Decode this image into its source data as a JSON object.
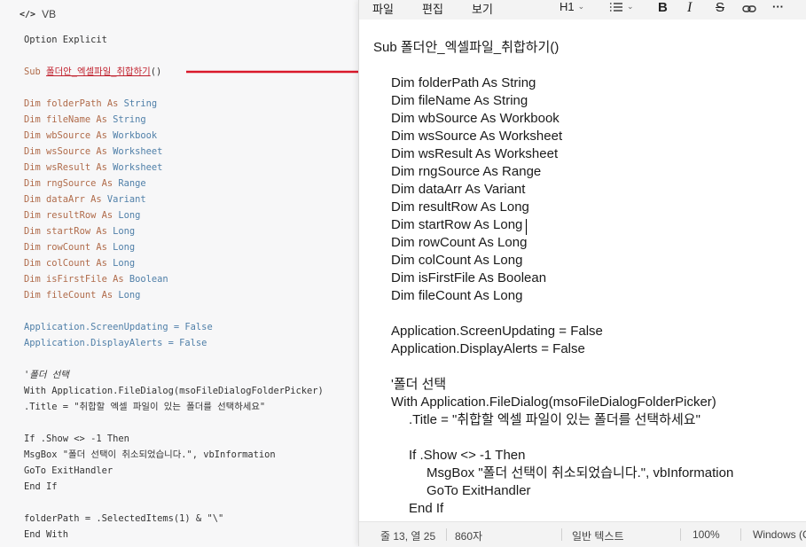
{
  "left_panel": {
    "lang_icon": "code-icon",
    "lang_label": "VB",
    "lines": {
      "option": "Option Explicit",
      "sub_kw": "Sub ",
      "sub_name": "폴더안_엑셀파일_취합하기",
      "sub_paren": "()",
      "dims": [
        {
          "name": "folderPath",
          "type": "String"
        },
        {
          "name": "fileName",
          "type": "String"
        },
        {
          "name": "wbSource",
          "type": "Workbook"
        },
        {
          "name": "wsSource",
          "type": "Worksheet"
        },
        {
          "name": "wsResult",
          "type": "Worksheet"
        },
        {
          "name": "rngSource",
          "type": "Range"
        },
        {
          "name": "dataArr",
          "type": "Variant"
        },
        {
          "name": "resultRow",
          "type": "Long"
        },
        {
          "name": "startRow",
          "type": "Long"
        },
        {
          "name": "rowCount",
          "type": "Long"
        },
        {
          "name": "colCount",
          "type": "Long"
        },
        {
          "name": "isFirstFile",
          "type": "Boolean"
        },
        {
          "name": "fileCount",
          "type": "Long"
        }
      ],
      "dim_kw": "Dim ",
      "as_kw": " As ",
      "screen_updating": "Application.ScreenUpdating = False",
      "display_alerts": "Application.DisplayAlerts = False",
      "comment": "'폴더 선택",
      "with_line": "With Application.FileDialog(msoFileDialogFolderPicker)",
      "title_line": ".Title = \"취합할 엑셀 파일이 있는 폴더를 선택하세요\"",
      "if_line": "If .Show <> -1 Then",
      "msgbox_line": "MsgBox \"폴더 선택이 취소되었습니다.\", vbInformation",
      "goto_line": "GoTo ExitHandler",
      "endif_line": "End If",
      "folderpath_line": "folderPath = .SelectedItems(1) & \"\\\"",
      "endwith_line": "End With"
    }
  },
  "notepad": {
    "menu": {
      "file": "파일",
      "edit": "편집",
      "view": "보기"
    },
    "toolbar": {
      "heading": "H1",
      "list_icon": "list-icon",
      "bold": "B",
      "italic": "I",
      "strike": "S",
      "link_icon": "link-icon",
      "more": "···"
    },
    "editor_lines": {
      "sub": "Sub 폴더안_엑셀파일_취합하기()",
      "dims": [
        "Dim folderPath As String",
        "Dim fileName As String",
        "Dim wbSource As Workbook",
        "Dim wsSource As Worksheet",
        "Dim wsResult As Worksheet",
        "Dim rngSource As Range",
        "Dim dataArr As Variant",
        "Dim resultRow As Long",
        "Dim startRow As Long",
        "Dim rowCount As Long",
        "Dim colCount As Long",
        "Dim isFirstFile As Boolean",
        "Dim fileCount As Long"
      ],
      "screen_updating": "Application.ScreenUpdating = False",
      "display_alerts": "Application.DisplayAlerts = False",
      "comment": "'폴더 선택",
      "with_line": "With Application.FileDialog(msoFileDialogFolderPicker)",
      "title_line": ".Title = \"취합할 엑셀 파일이 있는 폴더를 선택하세요\"",
      "if_line": "If .Show <> -1 Then",
      "msgbox_line": "MsgBox \"폴더 선택이 취소되었습니다.\", vbInformation",
      "goto_line": "GoTo ExitHandler",
      "endif_line": "End If"
    },
    "status": {
      "position": "줄 13, 열 25",
      "chars": "860자",
      "format": "일반 텍스트",
      "zoom": "100%",
      "encoding": "Windows (C"
    }
  },
  "colors": {
    "arrow": "#d9182a",
    "keyword": "#b06b4a",
    "type": "#4f7fa8"
  }
}
